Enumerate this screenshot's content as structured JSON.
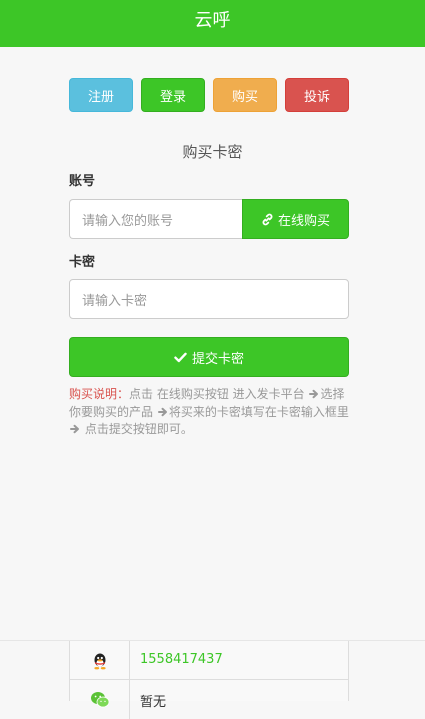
{
  "header": {
    "title": "云呼"
  },
  "nav_buttons": {
    "register": "注册",
    "login": "登录",
    "buy": "购买",
    "complain": "投诉"
  },
  "form": {
    "title": "购买卡密",
    "account_label": "账号",
    "account_placeholder": "请输入您的账号",
    "online_buy_label": "在线购买",
    "card_label": "卡密",
    "card_placeholder": "请输入卡密",
    "submit_label": "提交卡密"
  },
  "note": {
    "head": "购买说明：",
    "step1": "点击 在线购买按钮 进入发卡平台",
    "step2": "选择你要购买的产品",
    "step3": "将买来的卡密填写在卡密输入框里",
    "step4": "点击提交按钮即可。"
  },
  "contact": {
    "qq": "1558417437",
    "wechat": "暂无"
  },
  "colors": {
    "brand_green": "#3dc627",
    "info": "#5bc0de",
    "warning": "#f0ad4e",
    "danger": "#d9534f"
  },
  "icons": {
    "online_buy": "link-icon",
    "submit": "check-icon",
    "arrow": "arrow-right-icon",
    "qq": "qq-penguin-icon",
    "wechat": "wechat-icon"
  }
}
